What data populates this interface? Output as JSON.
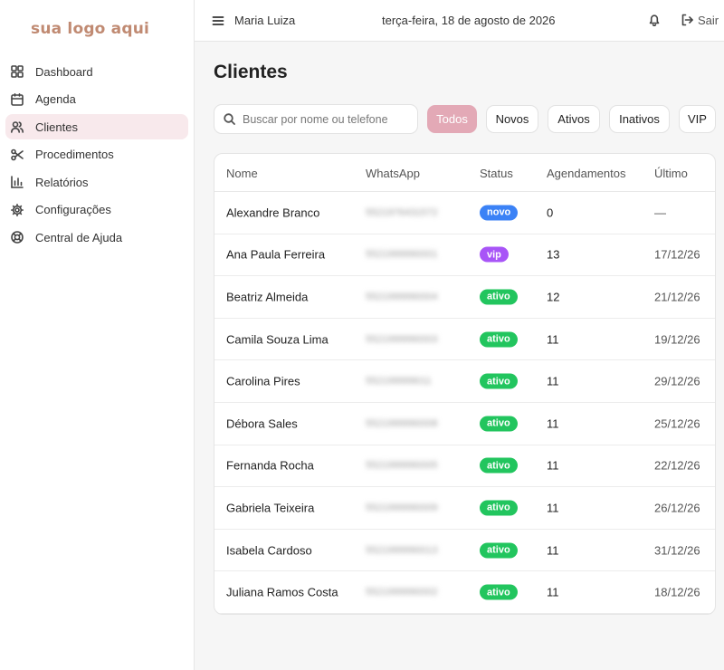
{
  "logo": "sua logo aqui",
  "nav": [
    {
      "label": "Dashboard",
      "icon": "dashboard-icon"
    },
    {
      "label": "Agenda",
      "icon": "calendar-icon"
    },
    {
      "label": "Clientes",
      "icon": "users-icon",
      "active": true
    },
    {
      "label": "Procedimentos",
      "icon": "scissors-icon"
    },
    {
      "label": "Relatórios",
      "icon": "bar-chart-icon"
    },
    {
      "label": "Configurações",
      "icon": "gear-icon"
    },
    {
      "label": "Central de Ajuda",
      "icon": "lifebuoy-icon"
    }
  ],
  "topbar": {
    "user_name": "Maria Luiza",
    "date": "terça-feira, 18 de agosto de 2026",
    "logout_label": "Sair"
  },
  "page_title": "Clientes",
  "search": {
    "placeholder": "Buscar por nome ou telefone",
    "value": ""
  },
  "filters": [
    {
      "label": "Todos",
      "active": true
    },
    {
      "label": "Novos"
    },
    {
      "label": "Ativos"
    },
    {
      "label": "Inativos"
    },
    {
      "label": "VIP"
    }
  ],
  "table": {
    "headers": [
      "Nome",
      "WhatsApp",
      "Status",
      "Agendamentos",
      "Último"
    ],
    "rows": [
      {
        "name": "Alexandre Branco",
        "phone": "5521976431572",
        "status": "novo",
        "agendamentos": "0",
        "ultimo": "—"
      },
      {
        "name": "Ana Paula Ferreira",
        "phone": "5521999990001",
        "status": "vip",
        "agendamentos": "13",
        "ultimo": "17/12/26"
      },
      {
        "name": "Beatriz Almeida",
        "phone": "5521999990004",
        "status": "ativo",
        "agendamentos": "12",
        "ultimo": "21/12/26"
      },
      {
        "name": "Camila Souza Lima",
        "phone": "5521999990003",
        "status": "ativo",
        "agendamentos": "11",
        "ultimo": "19/12/26"
      },
      {
        "name": "Carolina Pires",
        "phone": "552199999011",
        "status": "ativo",
        "agendamentos": "11",
        "ultimo": "29/12/26"
      },
      {
        "name": "Débora Sales",
        "phone": "5521999990008",
        "status": "ativo",
        "agendamentos": "11",
        "ultimo": "25/12/26"
      },
      {
        "name": "Fernanda Rocha",
        "phone": "5521999990005",
        "status": "ativo",
        "agendamentos": "11",
        "ultimo": "22/12/26"
      },
      {
        "name": "Gabriela Teixeira",
        "phone": "5521999990009",
        "status": "ativo",
        "agendamentos": "11",
        "ultimo": "26/12/26"
      },
      {
        "name": "Isabela Cardoso",
        "phone": "5521999990013",
        "status": "ativo",
        "agendamentos": "11",
        "ultimo": "31/12/26"
      },
      {
        "name": "Juliana Ramos Costa",
        "phone": "5521999990002",
        "status": "ativo",
        "agendamentos": "11",
        "ultimo": "18/12/26"
      }
    ]
  },
  "colors": {
    "logo": "#c08a72",
    "active_nav_bg": "#f8e9ec",
    "active_filter": "#e3a9b6",
    "badge_novo": "#3b82f6",
    "badge_vip": "#a855f7",
    "badge_ativo": "#22c55e"
  }
}
